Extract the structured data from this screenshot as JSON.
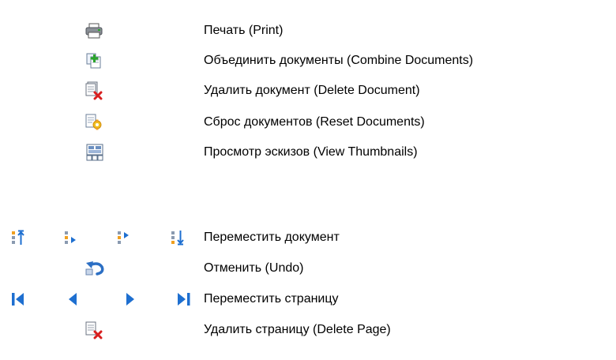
{
  "legend": {
    "items": [
      {
        "icon": "print-icon",
        "label": "Печать (Print)"
      },
      {
        "icon": "combine-documents-icon",
        "label": "Объединить документы (Combine Documents)"
      },
      {
        "icon": "delete-document-icon",
        "label": "Удалить документ (Delete Document)"
      },
      {
        "icon": "reset-documents-icon",
        "label": "Сброс документов (Reset Documents)"
      },
      {
        "icon": "view-thumbnails-icon",
        "label": "Просмотр эскизов (View Thumbnails)"
      },
      {
        "icons": [
          "move-document-top-icon",
          "move-document-up-icon",
          "move-document-down-icon",
          "move-document-bottom-icon"
        ],
        "label": "Переместить документ"
      },
      {
        "icon": "undo-icon",
        "label": "Отменить (Undo)"
      },
      {
        "icons": [
          "first-page-icon",
          "previous-page-icon",
          "next-page-icon",
          "last-page-icon"
        ],
        "label": "Переместить страницу"
      },
      {
        "icon": "delete-page-icon",
        "label": "Удалить страницу (Delete Page)"
      }
    ]
  },
  "colors": {
    "accent_blue": "#1e6fd0",
    "delete_red": "#d81e1e",
    "add_green": "#2aa52a",
    "orange": "#f0a020"
  }
}
